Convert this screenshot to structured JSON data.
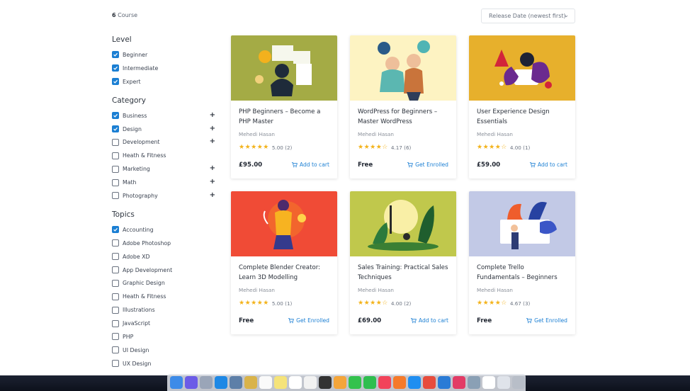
{
  "header": {
    "count_number": "6",
    "count_label": " Course",
    "sort_value": "Release Date (newest first)"
  },
  "filters": {
    "level": {
      "title": "Level",
      "items": [
        {
          "label": "Beginner",
          "checked": true,
          "expandable": false
        },
        {
          "label": "Intermediate",
          "checked": true,
          "expandable": false
        },
        {
          "label": "Expert",
          "checked": true,
          "expandable": false
        }
      ]
    },
    "category": {
      "title": "Category",
      "items": [
        {
          "label": "Business",
          "checked": true,
          "expandable": true
        },
        {
          "label": "Design",
          "checked": true,
          "expandable": true
        },
        {
          "label": "Development",
          "checked": false,
          "expandable": true
        },
        {
          "label": "Heath & Fitness",
          "checked": false,
          "expandable": false
        },
        {
          "label": "Marketing",
          "checked": false,
          "expandable": true
        },
        {
          "label": "Math",
          "checked": false,
          "expandable": true
        },
        {
          "label": "Photography",
          "checked": false,
          "expandable": true
        }
      ]
    },
    "topics": {
      "title": "Topics",
      "items": [
        {
          "label": "Accounting",
          "checked": true,
          "expandable": false
        },
        {
          "label": "Adobe Photoshop",
          "checked": false,
          "expandable": false
        },
        {
          "label": "Adobe XD",
          "checked": false,
          "expandable": false
        },
        {
          "label": "App Development",
          "checked": false,
          "expandable": false
        },
        {
          "label": "Graphic Design",
          "checked": false,
          "expandable": false
        },
        {
          "label": "Heath & Fitness",
          "checked": false,
          "expandable": false
        },
        {
          "label": "Illustrations",
          "checked": false,
          "expandable": false
        },
        {
          "label": "JavaScript",
          "checked": false,
          "expandable": false
        },
        {
          "label": "PHP",
          "checked": false,
          "expandable": false
        },
        {
          "label": "UI Design",
          "checked": false,
          "expandable": false
        },
        {
          "label": "UX Design",
          "checked": false,
          "expandable": false
        }
      ]
    }
  },
  "courses": [
    {
      "title": "PHP Beginners – Become a PHP Master",
      "author": "Mehedi Hasan",
      "rating": "5.00",
      "reviews": "(2)",
      "stars": 5,
      "price": "£95.00",
      "cta": "Add to cart",
      "thumb_color": "#a4ab45"
    },
    {
      "title": "WordPress for Beginners – Master WordPress",
      "author": "Mehedi Hasan",
      "rating": "4.17",
      "reviews": "(6)",
      "stars": 4,
      "price": "Free",
      "cta": "Get Enrolled",
      "thumb_color": "#fdf3c2"
    },
    {
      "title": "User Experience Design Essentials",
      "author": "Mehedi Hasan",
      "rating": "4.00",
      "reviews": "(1)",
      "stars": 4,
      "price": "£59.00",
      "cta": "Add to cart",
      "thumb_color": "#e7b02c"
    },
    {
      "title": "Complete Blender Creator: Learn 3D Modelling",
      "author": "Mehedi Hasan",
      "rating": "5.00",
      "reviews": "(1)",
      "stars": 5,
      "price": "Free",
      "cta": "Get Enrolled",
      "thumb_color": "#f04b36"
    },
    {
      "title": "Sales Training: Practical Sales Techniques",
      "author": "Mehedi Hasan",
      "rating": "4.00",
      "reviews": "(2)",
      "stars": 4,
      "price": "£69.00",
      "cta": "Add to cart",
      "thumb_color": "#c0c84c"
    },
    {
      "title": "Complete Trello Fundamentals – Beginners",
      "author": "Mehedi Hasan",
      "rating": "4.67",
      "reviews": "(3)",
      "stars": 4,
      "price": "Free",
      "cta": "Get Enrolled",
      "thumb_color": "#c2c9e6"
    }
  ],
  "colors": {
    "accent": "#1b7fd3",
    "star": "#f3b31b"
  },
  "dock": {
    "icons": [
      "finder-icon",
      "siri-icon",
      "launchpad-icon",
      "safari-icon",
      "preview-icon",
      "notes-icon",
      "calendar-icon",
      "stickies-icon",
      "reminders-icon",
      "textedit-icon",
      "quicktime-icon",
      "photos-icon",
      "messages-icon",
      "facetime-icon",
      "music-icon",
      "books-icon",
      "app-store-icon",
      "chrome-icon",
      "vscode-icon",
      "slack-icon",
      "elephant-icon",
      "documents-icon",
      "finder-window-icon",
      "trash-icon"
    ]
  }
}
